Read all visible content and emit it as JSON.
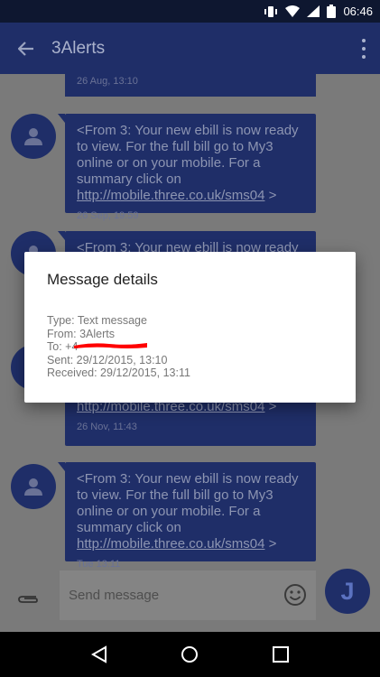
{
  "status_bar": {
    "time": "06:46",
    "icons": [
      "vibrate-icon",
      "wifi-icon",
      "signal-icon",
      "battery-icon"
    ],
    "battery_level": "99"
  },
  "app_bar": {
    "title": "3Alerts",
    "back_icon": "arrow-back-icon",
    "menu_icon": "overflow-menu-icon"
  },
  "messages": [
    {
      "text": "",
      "time": "26 Aug, 13:10"
    },
    {
      "text": "<From 3: Your new ebill is now ready to view. For the full bill go to My3 online or on your mobile. For a summary click on ",
      "link": "http://mobile.three.co.uk/sms04",
      "suffix": " >",
      "time": "26 Sep, 19:59"
    },
    {
      "text": "<From 3: Your new ebill is now ready to",
      "time": ""
    },
    {
      "text": "",
      "link": "http://mobile.three.co.uk/sms04",
      "suffix": " >",
      "time": "26 Nov, 11:43"
    },
    {
      "text": "<From 3: Your new ebill is now ready to view. For the full bill go to My3 online or on your mobile. For a summary click on ",
      "link": "http://mobile.three.co.uk/sms04",
      "suffix": " >",
      "time": "Tue 13:11"
    }
  ],
  "compose": {
    "placeholder": "Send message",
    "send_letter": "J"
  },
  "dialog": {
    "title": "Message details",
    "type": "Type: Text message",
    "from": "From: 3Alerts",
    "to": "To: +4",
    "sent": "Sent: 29/12/2015, 13:10",
    "received": "Received: 29/12/2015, 13:11"
  },
  "colors": {
    "accent": "#1f2e68",
    "redaction": "#ff0000"
  }
}
